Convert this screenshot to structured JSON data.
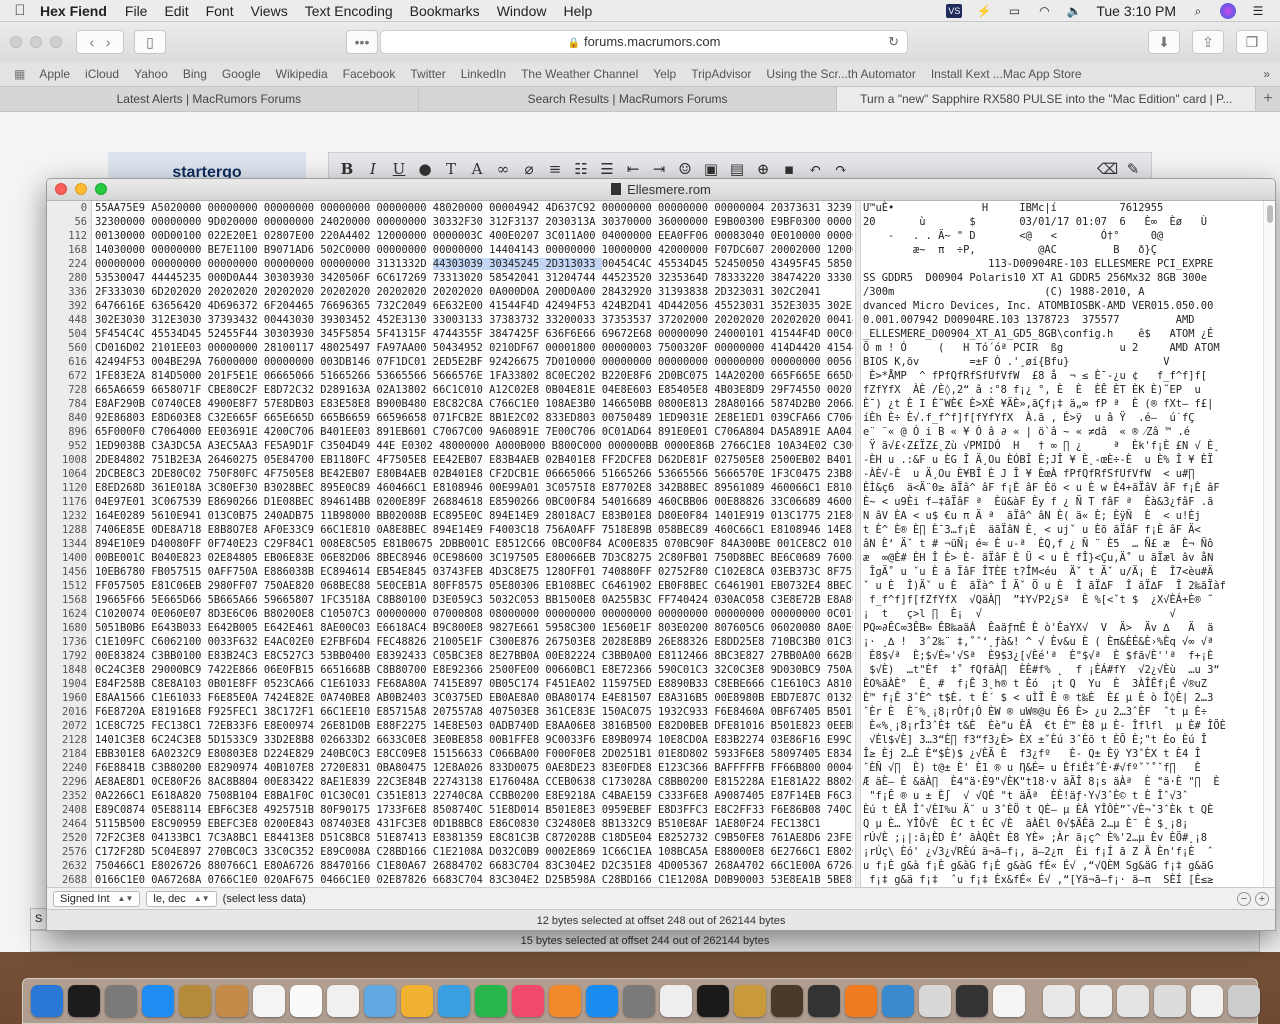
{
  "menubar": {
    "app_name": "Hex Fiend",
    "items": [
      "File",
      "Edit",
      "Font",
      "Views",
      "Text Encoding",
      "Bookmarks",
      "Window",
      "Help"
    ],
    "clock": "Tue 3:10 PM"
  },
  "safari": {
    "url": "forums.macrumors.com",
    "bookmarks": [
      "Apple",
      "iCloud",
      "Yahoo",
      "Bing",
      "Google",
      "Wikipedia",
      "Facebook",
      "Twitter",
      "LinkedIn",
      "The Weather Channel",
      "Yelp",
      "TripAdvisor",
      "Using the Scr...th Automator",
      "Install Kext ...Mac App Store"
    ],
    "tabs": [
      "Latest Alerts | MacRumors Forums",
      "Search Results | MacRumors Forums",
      "Turn a \"new\" Sapphire RX580 PULSE into the \"Mac Edition\" card | P..."
    ],
    "profile_name": "startergo"
  },
  "hexfiend": {
    "title": "Ellesmere.rom",
    "rows": [
      {
        "offset": "0",
        "hex": "55AA75E9 A5020000 00000000 00000000 00000000 00000000 48020000 00004942 4D637C92 00000000 00000000 00000004 20373631 32393535",
        "ascii": "U™uÈ•              H     IBMc|í          7612955"
      },
      {
        "offset": "56",
        "hex": "32300000 00000000 9D020000 00000000 24020000 00000000 30332F30 312F3137 2030313A 30370000 36000000 E9B00300 E9BF0300 0000F400",
        "ascii": "20       ù       $       03/01/17 01:07  6   È∞  Èø   Ù"
      },
      {
        "offset": "112",
        "hex": "00130000 00D00100 022E20E1 02807E00 220A4402 12000000 0000003C 400E0207 3C011A00 04000000 EEA0FF06 00083040 0E010000 00000000",
        "ascii": "    -   . . Ä~ \" D       <@   <       Ó†°     0@"
      },
      {
        "offset": "168",
        "hex": "14030000 00000000 BE7E1100 B9071AD6 502C0000 00000000 00000000 14404143 00000000 10000000 42000000 F07DC607 20002000 12000E00",
        "ascii": "        æ~  π  ÷P,          @AC         B   ð}Ç  "
      },
      {
        "offset": "224",
        "hex": "00000000 00000000 00000000 00000000 00000000 3131332D 44303039 30345245 2D313033 00454C4C 45534D45 52450050 43495F45 58505245",
        "ascii": "                    113-D00904RE-103 ELLESMERE PCI_EXPRE"
      },
      {
        "offset": "280",
        "hex": "53530047 44445235 000D0A44 30303930 3420506F 6C617269 73313020 58542041 31204744 44523520 3235364D 78333220 38474220 33303065",
        "ascii": "SS GDDR5  D00904 Polaris10 XT A1 GDDR5 256Mx32 8GB 300e"
      },
      {
        "offset": "336",
        "hex": "2F333030 6D202020 20202020 20202020 20202020 20202020 20202020 0A000D0A 200D0A00 28432920 31393838 2D323031 302C2041",
        "ascii": "/300m                        (C) 1988-2010, A"
      },
      {
        "offset": "392",
        "hex": "6476616E 63656420 4D696372 6F204465 76696365 732C2049 6E632E00 41544F4D 42494F53 424B2D41 4D442056 45523031 352E3035 302E30",
        "ascii": "dvanced Micro Devices, Inc. ATOMBIOSBK-AMD VER015.050.00"
      },
      {
        "offset": "448",
        "hex": "302E3030 312E3030 37393432 00443030 39303452 452E3130 33003133 37383732 33200033 37353537 37202000 20202020 20202020 00414D44",
        "ascii": "0.001.007942 D00904RE.103 1378723  375577         AMD"
      },
      {
        "offset": "504",
        "hex": "5F454C4C 45534D45 52455F44 30303930 345F5854 5F41315F 4744355F 3847425F 636F6E66 69672E68 00000090 24000101 41544F4D 00C0C903",
        "ascii": "_ELLESMERE_D00904_XT_A1_GD5_8GB\\config.h    ê$   ATOM ¿É"
      },
      {
        "offset": "560",
        "hex": "CD016D02 2101EE03 00000000 28100117 48025497 FA97AA00 50434952 0210DF67 00001800 00000003 7500320F 00000000 414D4420 41544F4D",
        "ascii": "Õ m ! Ó     (   H Tó´óª PCIR  ßg         u 2     AMD ATOM"
      },
      {
        "offset": "616",
        "hex": "42494F53 004BE29A 76000000 00000000 003DB146 07F1DC01 2ED5E2BF 92426675 7D010000 00000000 00000000 00000000 00000000 00561E0E",
        "ascii": "BIOS K‚öv        =±F Ò .'¸øí{Bfu}               V"
      },
      {
        "offset": "672",
        "hex": "1FE83E2A 814D5000 201F5E1E 06665066 51665266 53665566 5666576E 1FA33802 8C0EC202 B220E8F6 2D0BC075 14A20200 665F665E 665D665B",
        "ascii": " È>*ÅMP  ^ fPfQfRfSfUfVfW  £8 å  ¬ ≤ È¯-¿u ¢   f_f^f]f["
      },
      {
        "offset": "728",
        "hex": "665A6659 6658071F CBE80C2F E8D72C32 D289163A 02A13802 66C1C010 A12C02E8 0B04E81E 04E8E603 E85405E8 4B03E8D9 29F74550 00207513",
        "ascii": "fZfYfX  ÀÈ /È◊,2“ â :°8 f¡¿ °, È  È  ÈÊ ÈT ÈK È)˜EP  u"
      },
      {
        "offset": "784",
        "hex": "E8AF290B C0740CE8 4900E8F7 57E8DB03 E83E58E8 B900B480 E8C82C8A C766C1E0 108AE3B0 146650BB 0800E813 28A80166 5874D2B0 2066A37C",
        "ascii": "È¯) ¿t È I È˜WÈ€ È>XÈ ¥ÄÈ»,äÇf¡‡ ä„∞ fP ª  È (® fXt— f£|"
      },
      {
        "offset": "840",
        "hex": "92E86803 E8D603E8 C32E665F 665E665D 665B6659 66596658 071FCB2E 8B1E2C02 833ED803 00750489 1ED9031E 2E8E1ED1 039CFA66 C7060801",
        "ascii": "íÈh È÷ È√.f_f^f]f[fYfYfX  À.ã , É>ÿ  u â Ÿ  .é—  ú˙fÇ"
      },
      {
        "offset": "896",
        "hex": "65F000F0 C7064000 EE03691E 4200C706 B401EE03 891EB601 C7067C00 9A60891E 7E00C706 0C01AD64 891E0E01 C706A804 DA5A891E AA042E8E",
        "ascii": "e¨ ¨« @ Ó i B « ¥ Ó â ∂ « | ö`â ~ « ≠dâ  « ® ⁄Zâ ™ .é"
      },
      {
        "offset": "952",
        "hex": "1ED9038B C3A3DC5A A3EC5AA3 FE5A9D1F C3504D49 44E E0302 48000000 A000B000 B800C000 000000BB 0000E86B 2766C1E8 10A34E02 C300E8FF",
        "ascii": " Ÿ ã√£‹Z£ÏZ£˛Zù √PMIDÓ  H   † ∞ ∏ ¿     ª  Èk'f¡È £N √ È˛"
      },
      {
        "offset": "1008",
        "hex": "2DE84802 751B2E3A 26460275 05E84700 EB1180FC 4F7505E8 EE42EB07 E83B4AEB 02B401E8 FF2DCFE8 D62DE81F 027505E8 2500EB02 B401E8EC",
        "ascii": "-ÈH u .:&F u ÈG Î Ä¸Ou ÈÓBÎ È;JÎ ¥ È˛-œÈ÷-È  u È% Î ¥ ÈÏ"
      },
      {
        "offset": "1064",
        "hex": "2DCBE8C3 2DE80C02 750F80FC 4F7505E8 BE42EB07 E80B4AEB 02B401E8 CF2DCB1E 06665066 51665266 53665566 5666570E 1F3C0475 23B80B00",
        "ascii": "-ÀÈ√-È  u Ä¸Ou È¥BÎ È J Î ¥ ÈœÀ fPfQfRfSfUfVfW  < u#∏"
      },
      {
        "offset": "1120",
        "hex": "E8ED268D 361E018A 3C80EF30 B3028BEC 895E0C89 460466C1 E8108946 00E99A01 3C0575I8 E87702E8 342B8BEC 89561089 460066C1 E8108946",
        "ascii": "ÈÌ&ç6  ä<Ä¨0≥ ãÏâ^ âF f¡È âF Èö < u È w È4+ãÏâV âF f¡È âF"
      },
      {
        "offset": "1176",
        "hex": "04E97E01 3C067539 E8690266 D1E08BEC 894614BB 0200E89F 26884618 E8590266 0BC00F84 54016689 460CBB06 00E88826 33C06689 46002E8B",
        "ascii": "È~ < u9Èi f—‡ãÏâF ª  Èü&àF Èy f ¿ Ñ T fâF ª  Èà&3¿fâF .ã"
      },
      {
        "offset": "1232",
        "hex": "164E0289 5610E941 013C0B75 240ADB75 11B98000 BB02008B EC895E0C 894E14E9 28018AC7 E83B01E8 D80E0F84 1401E919 013C1775 21E86A06",
        "ascii": "N âV ÈA < u$ €u π Ä ª  ãÏâ^ âN È( ä« È; ÈÿÑ  È  < u!Èj"
      },
      {
        "offset": "1288",
        "hex": "7406E85E 0DE8A718 E8B8O7E8 AF0E33C9 66C1E810 0A8E8BEC 894E14E9 F4003C18 756A0AFF 7518E89B 058BEC89 460C66C1 E8108946 14E83C08",
        "ascii": "t È^ È® È∏ È¯3…f¡È  äãÏâN È˛ < ujˇ u Èõ ãÏâF f¡È âF Ä<"
      },
      {
        "offset": "1344",
        "hex": "894E10E9 D40080FF 0F740E23 C29F84C1 008E8C505 E81B0675 2DBB001C E8512C66 0BC00F84 AC00E835 070BC90F 84A300BE 001CE8C2 010F8499",
        "ascii": "âN È‘ Äˇ t # ¬üÑ¡ é≈ È u-ª  ÈQ,f ¿ Ñ ¨ È5  … Ñ£ æ  È¬ Ñô"
      },
      {
        "offset": "1400",
        "hex": "00BE001C B040E823 02E84805 EB06E83E 06E82D06 8BEC8946 0CE98600 3C197505 E80066EB 7D3C8275 2C80FB01 750D8BEC BE6C0689 76008C4E",
        "ascii": "æ  ∞@È# ÈH Î È> È- ãÏâF È Ü < u È fÎ}<Çu,Ä˚ u ãÏæl âv åN"
      },
      {
        "offset": "1456",
        "hex": "10EB6780 FB057515 0AFF750A E886038B EC894614 EB54E845 03743FEB 4D3C8E75 128OFF01 740880FF 02752F80 C102E8CA 03EB373C 8F75238O",
        "ascii": " ÎgÄ˚ u ˇu È ã ÏâF ÎTÈE t?ÎM<éu  Äˇ t Äˇ u/Ä¡ È  Î7<èu#Ä"
      },
      {
        "offset": "1512",
        "hex": "FF057505 E81C06EB 2980FF07 750AE820 068BEC88 5E0CEB1A 80FF8575 05E80306 EB108BEC C6461902 EB0F8BEC C6461901 EB0732E4 8BEC8866",
        "ascii": "ˇ u È  Î)Äˇ u È  ãÏà^ Î Äˇ Ö u È  Î ãÏ∆F  Î ãÏ∆F  Î 2‰ãÏàf"
      },
      {
        "offset": "1568",
        "hex": "19665F66 5E665D66 5B665A66 59665807 1FC3518A C8B80100 D3E059C3 5032C053 BB1500E8 0A255B3C FF740424 030AC058 C3E8E72B E8A806F7",
        "ascii": " f_f^f]f[fZfYfX  √QäÀ∏  ”‡Y√P2¿Sª  È %[<ˇt $  ¿X√ÈÁ+È® ˜"
      },
      {
        "offset": "1624",
        "hex": "C1020074 0E060E07 8D3E6C06 B8020OE8 C10507C3 00000000 07000808 08000000 00000000 00000000 00000000 00000000 00000000 0C01C300",
        "ascii": "¡  t   ç>l ∏  È¡  √                              √"
      },
      {
        "offset": "1680",
        "hex": "5051B0B6 E643B033 E642B005 E642E461 8AE00C03 E6618AC4 B9C800E8 9827E661 5958C300 1E560E1F 803E0200 807605C6 06020080 8A0E0200",
        "ascii": "PQ∞∂ÊC∞3ÊB∞ ÊB‰aäÁ  ÊaäƒπÈ È ò'ÊaYX√  V  Ä>  Äv ∆   Ä  ä"
      },
      {
        "offset": "1736",
        "hex": "C1E109FC C6062100 0033F632 E4AC02E0 E2FBF6D4 FEC48826 21005E1F C300E876 267503E8 2028E8B9 26E88326 E8DD25E8 710BC3B0 01C3BB01",
        "ascii": "¡· ¸∆ !  3ˆ2‰¨ ‡‚˚ˆ‘˛ƒà&! ^ √ Èv&u È ( Èπ&ÈÉ&È›%Èq √∞ √ª"
      },
      {
        "offset": "1792",
        "hex": "00E83824 C3BB0100 E83B24C3 E8C527C3 53BB0400 E8392433 C05BC3E8 8E27BB0A 00E82224 C3BB0A00 E8112466 8BC3E827 27BB0A00 662BC1E8",
        "ascii": " È8$√ª  È;$√È≈'√Sª  È9$3¿[√Èé'ª  È\"$√ª  È $fã√È''ª  f+¡È"
      },
      {
        "offset": "1848",
        "hex": "0C24C3E8 29000BC9 7422E866 06E0FB15 6651668B C8B80700 E8E92366 2500FE00 00660BC1 E8E72366 590C01C3 32C0C3E8 9D030BC9 750A33D2",
        "ascii": " $√È)  …t\"Èf  ‡˚ fQfãÀ∏  ÈÈ#f% ˛  f ¡ÈÁ#fY  √2¿√Èù  …u 3“"
      },
      {
        "offset": "1904",
        "hex": "E84F258B C8E8A103 0B01E8FF 0523CA66 C1E61033 FE68A80A 7415E897 0B05C174 F451EA02 115975ED E8890B33 C8EBE666 C1E610C3 A810755A",
        "ascii": "ÈO%ãÀÈ°  È˛ #  f¡Ê 3˛h® t Èó  ¡t Q  Yu  È  3ÀÎÊf¡Ê √®uZ"
      },
      {
        "offset": "1960",
        "hex": "E8AA1566 C1E61033 F6E85E0A 7424E82E 0A740BE8 AB0B2403 3C0375ED EB0AE8A0 0BA80174 E4E81507 E8A316B5 00E8980B EBD7E87C 0132C933",
        "ascii": "È™ f¡Ê 3ˆÈ^ t$È. t È´ $ < uÌÎ Ȇ ® t‰È  È£ µ È ò Î◊È| 2…3"
      },
      {
        "offset": "2016",
        "hex": "F6E8720A E81916E8 F925FEC1 38C172F1 66C1EE10 E85715A8 207557A8 407503E8 361CE83E 150AC075 1932C933 F6E8460A 0BF67405 B501E8D6",
        "ascii": "ˆÈr È  È˘%˛¡8¡rÒf¡Ó ÈW ® uW®@u È6 È> ¿u 2…3ˆÈF  ˆt µ È÷"
      },
      {
        "offset": "2072",
        "hex": "1CE8C725 FEC138C1 72EB33F6 E8E00974 26E81D0B E88F2275 14E8E503 0ADB740D E8AA06E8 3816B500 E82D0BEB DFE81016 B501E823 0EEBD5E8",
        "ascii": " È«%˛¡8¡rÎ3ˆÈ‡ t&È  Èè\"u ÈÂ  €t È™ È8 µ È- Îflfl  µ È# ÎÕÈ"
      },
      {
        "offset": "2128",
        "hex": "1401C3E8 6C24C3E8 5D1533C9 33D2E8B8 026633D2 6633C0E8 3E0BE858 00B1FFE8 9C0033F6 E89B0974 10E8CD0A E83B2274 03E86F16 E99C16EB",
        "ascii": " √Èl$√È] 3…3“È∏ f3“f3¿È> ÈX ±ˇÈú 3ˆÈõ t ÈÕ È;\"t Èo Èú Î"
      },
      {
        "offset": "2184",
        "hex": "EBB301E8 6A0232C9 E80803E8 D224E829 240BC0C3 E8CC09E8 15156633 C066BA00 F000F0E8 2D0251B1 01E8D802 5933F6E8 58097405 E83416EB",
        "ascii": "Î≥ Èj 2…È È“$È)$ ¿√ÈÃ È  f3¿fº   È- Q± Èÿ Y3ˆÈX t È4 Î"
      },
      {
        "offset": "2240",
        "hex": "F6E8841B C3B80200 E8290974 40B107E8 2720E831 0BA80475 12E8A026 833D0075 0AE8DE23 83E0FDE8 E123C366 BAFFFFFB FF66B800 000400E8",
        "ascii": "ˆÈÑ √∏  È) t@± È' È1 ® u Ƞ&É= u ÈfiÉ‡˝È·#√fºˇˇ˚ˇf∏   È"
      },
      {
        "offset": "2296",
        "hex": "AE8AE8D1 0CE80F26 8AC8B804 00E83422 8AE1E839 22C3E84B 22743138 E176048A CCEB0638 C173028A C8BB0200 E815228A E1E81A22 B80200E8",
        "ascii": "Æ äÈ— È &äÀ∏  È4\"ä·È9\"√ÈK\"t18·v äÃÎ 8¡s äÀª  È \"ä·È \"∏  È"
      },
      {
        "offset": "2352",
        "hex": "0A2266C1 E618A820 7508B104 E8BA1F0C 01C30C01 C351E813 22740C8A CCBB0200 E8E9218A C4BAE159 C333F6E8 A9087405 E87F14EB F6C333F6",
        "ascii": " \"f¡Ê ® u ± È∫  √ √QÈ \"t äÃª  ÈÈ!äƒ·Y√3ˆÈ© t È Îˆ√3ˆ"
      },
      {
        "offset": "2408",
        "hex": "E89C0874 05E88114 EBF6C3E8 4925751B 80F90175 1733F6E8 8508740C 51E8D014 B501E8E3 0959EBEF E8D3FFC3 E8C2FF33 F6E86B08 740C51E8",
        "ascii": "Èú t ÈÅ Îˆ√ÈI%u Ä˘ u 3ˆÈÖ t QÈ– µ ÈÂ YÎÔÈ”ˇ√È¬ˇ3ˆÈk t QÈ"
      },
      {
        "offset": "2464",
        "hex": "5115B500 E8C90959 EBEFC3E8 0200E843 087403E8 431FC3E8 0D1B8BC8 E86C0830 C32480E8 8B1332C9 B510E8AF 1AE80F24 FEC138C1",
        "ascii": "Q µ È… YÎÔ√È  ÈC t ÈC √È  ãÀÈl 0√$ÄÈã 2…µ È¯ È $˛¡8¡"
      },
      {
        "offset": "2520",
        "hex": "72F2C3E8 04133BC1 7C3A8BC1 E84413E8 D51C8BC8 51E87413 E8381359 E8C81C3B C872028B C18D5E04 E8252732 C9B50FE8 761AE8D6 23FEC138",
        "ascii": "rÚ√È ;¡|:ã¡ÈD È’ ãÀQÈt È8 YÈ» ;Àr ã¡ç^ È%'2…µ Èv ÈÖ#˛¡8"
      },
      {
        "offset": "2576",
        "hex": "C172F28D 5C04E897 270BC0C3 33C0C352 E89C008A C28BD166 C1E2108A D032C0B9 0002E869 1C66C1EA 108BCA5A E88000E8 6E2766C1 E8020AF6",
        "ascii": "¡rÚç\\ Èó' ¿√3¿√RÈú ä¬ã—f¡‚ ä–2¿π  Èi f¡Í ã Z Ȁ Èn'f¡È  ˆ"
      },
      {
        "offset": "2632",
        "hex": "750466C1 E8026726 880766C1 E80A6726 88470166 C1E80A67 26884702 6683C704 83C304E2 D2C351E8 4D005367 268A4702 66C1E00A 67268A47",
        "ascii": "u f¡È g&à f¡È g&àG f¡È g&àG fÉ« É√ ‚“√QÈM Sg&äG f¡‡ g&äG"
      },
      {
        "offset": "2688",
        "hex": "0166C1E0 0A67268A 0766C1E0 020AF675 0466C1E0 02E87826 6683C704 83C304E2 D25B598A C28BD166 C1E1208A D0B90003 53E8EA1B 5BE8B2B3",
        "ascii": " f¡‡ g&ä f¡‡  ˆu f¡‡ Èx&fÉ« É√ ‚“[Yä¬ã—f¡· ä–π  SÈÍ [È≤≥"
      }
    ],
    "status": {
      "type": "Signed Int",
      "endian": "le, dec",
      "value": "(select less data)",
      "selection": "12 bytes selected at offset 248 out of 262144 bytes"
    }
  },
  "background_window": {
    "selection": "15 bytes selected at offset 244 out of 262144 bytes"
  },
  "dock": {
    "colors": [
      "#2a78d6",
      "#1c1c1c",
      "#7a7a7a",
      "#1e8cf0",
      "#b58a3a",
      "#c48a4a",
      "#f4f4f4",
      "#fafafa",
      "#f0f0f0",
      "#60a8e0",
      "#f0b030",
      "#3a9fe0",
      "#28b54c",
      "#f04a6a",
      "#f08a2a",
      "#1a8cf0",
      "#7a7a7a",
      "#eeeeee",
      "#1a1a1a",
      "#c89a3a",
      "#4a3a2a",
      "#333333",
      "#f07a20",
      "#3a8ad0",
      "#d8d8d8",
      "#333333",
      "#f4f4f4",
      "#e8e8e8",
      "#ececec",
      "#e4e4e4",
      "#dcdcdc",
      "#f0f0f0",
      "#cccccc"
    ]
  }
}
